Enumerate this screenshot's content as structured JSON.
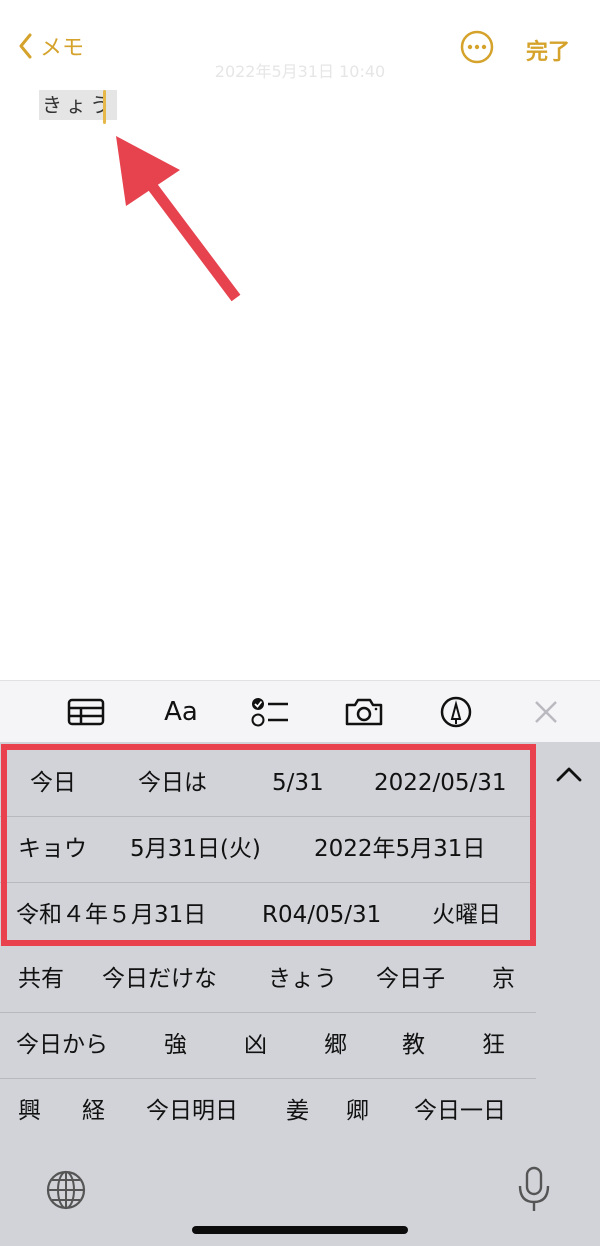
{
  "nav": {
    "back_label": "メモ",
    "timestamp": "2022年5月31日 10:40",
    "done_label": "完了"
  },
  "note": {
    "text": "きょう"
  },
  "toolbar": {
    "icons": [
      "table-icon",
      "text-format-icon",
      "checklist-icon",
      "camera-icon",
      "markup-icon",
      "close-icon"
    ],
    "format_label": "Aa"
  },
  "candidates": {
    "rows": [
      [
        "今日",
        "今日は",
        "5/31",
        "2022/05/31"
      ],
      [
        "キョウ",
        "5月31日(火)",
        "2022年5月31日"
      ],
      [
        "令和４年５月31日",
        "R04/05/31",
        "火曜日"
      ],
      [
        "共有",
        "今日だけな",
        "きょう",
        "今日子",
        "京"
      ],
      [
        "今日から",
        "強",
        "凶",
        "郷",
        "教",
        "狂"
      ],
      [
        "興",
        "経",
        "今日明日",
        "姜",
        "卿",
        "今日一日"
      ]
    ]
  },
  "colors": {
    "accent": "#d5a32b",
    "highlight": "#e9424e",
    "keyboard_bg": "#d1d3d8",
    "arrow": "#e6434f"
  },
  "bottom": {
    "icons": [
      "globe-icon",
      "microphone-icon"
    ]
  }
}
